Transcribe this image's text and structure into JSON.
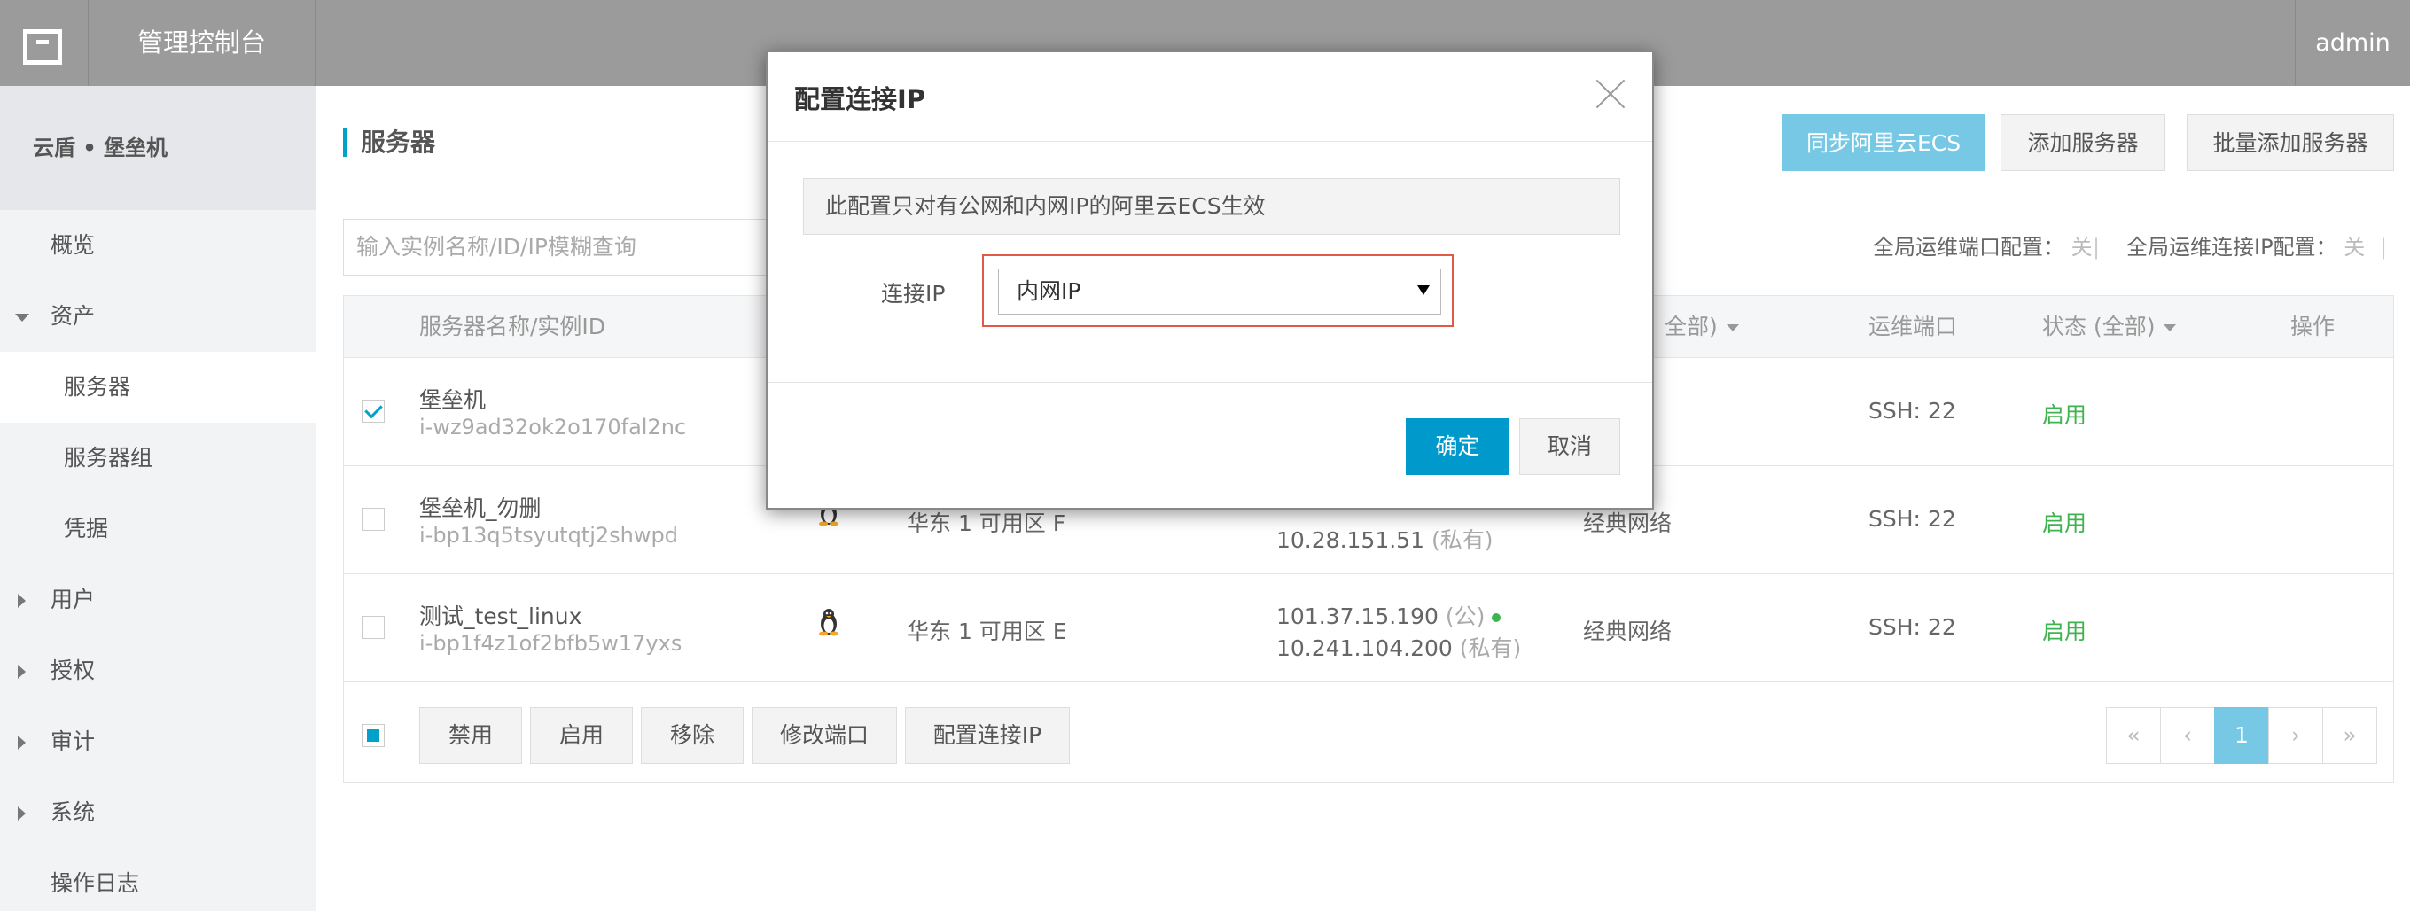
{
  "topbar": {
    "title": "管理控制台",
    "user": "admin"
  },
  "sidebar": {
    "product": "云盾 • 堡垒机",
    "items": [
      {
        "label": "概览"
      },
      {
        "label": "资产"
      },
      {
        "label": "服务器"
      },
      {
        "label": "服务器组"
      },
      {
        "label": "凭据"
      },
      {
        "label": "用户"
      },
      {
        "label": "授权"
      },
      {
        "label": "审计"
      },
      {
        "label": "系统"
      },
      {
        "label": "操作日志"
      }
    ]
  },
  "main": {
    "title": "服务器",
    "buttons": {
      "sync": "同步阿里云ECS",
      "add": "添加服务器",
      "batch_add": "批量添加服务器"
    },
    "search_placeholder": "输入实例名称/ID/IP模糊查询",
    "global_port_label": "全局运维端口配置：",
    "global_port_value": "关",
    "global_ip_label": "全局运维连接IP配置：",
    "global_ip_value": "关",
    "separator": "|"
  },
  "table": {
    "columns": {
      "name": "服务器名称/实例ID",
      "network": "全部)",
      "port": "运维端口",
      "status": "状态 (全部)",
      "action": "操作"
    },
    "rows": [
      {
        "name": "堡垒机",
        "id": "i-wz9ad32ok2o170fal2nc",
        "zone": "",
        "ip_public": "",
        "ip_private": "",
        "network": "",
        "port": "SSH: 22",
        "status": "启用",
        "checked": true
      },
      {
        "name": "堡垒机_勿删",
        "id": "i-bp13q5tsyutqtj2shwpd",
        "zone": "华东 1 可用区 F",
        "ip_public": "",
        "ip_private": "10.28.151.51",
        "ip_private_tag": "(私有)",
        "network": "经典网络",
        "port": "SSH: 22",
        "status": "启用",
        "checked": false
      },
      {
        "name": "测试_test_linux",
        "id": "i-bp1f4z1of2bfb5w17yxs",
        "zone": "华东 1 可用区 E",
        "ip_public": "101.37.15.190",
        "ip_public_tag": "(公)",
        "ip_private": "10.241.104.200",
        "ip_private_tag": "(私有)",
        "network": "经典网络",
        "port": "SSH: 22",
        "status": "启用",
        "checked": false
      }
    ],
    "footer_buttons": {
      "disable": "禁用",
      "enable": "启用",
      "remove": "移除",
      "modify_port": "修改端口",
      "config_ip": "配置连接IP"
    },
    "pager": {
      "first": "«",
      "prev": "‹",
      "current": "1",
      "next": "›",
      "last": "»"
    }
  },
  "modal": {
    "title": "配置连接IP",
    "notice": "此配置只对有公网和内网IP的阿里云ECS生效",
    "field_label": "连接IP",
    "select_value": "内网IP",
    "ok": "确定",
    "cancel": "取消"
  },
  "colors": {
    "accent": "#00a2ca",
    "primary_button": "#0099cc",
    "status_green": "#3fb34f",
    "highlight_border": "#e05a46"
  }
}
